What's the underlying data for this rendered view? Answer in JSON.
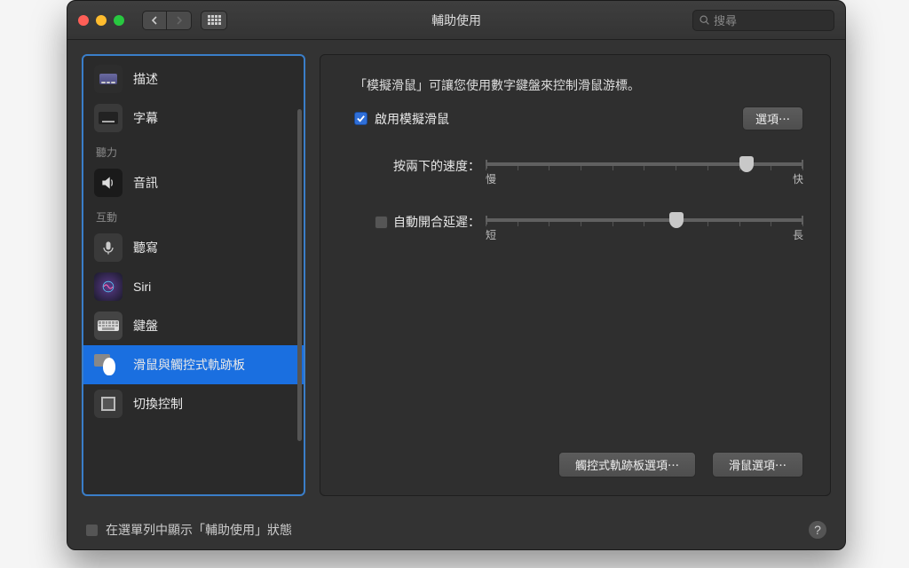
{
  "titlebar": {
    "title": "輔助使用",
    "search_placeholder": "搜尋"
  },
  "sidebar": {
    "categories": [
      {
        "label": "",
        "items": [
          {
            "key": "description",
            "label": "描述"
          },
          {
            "key": "subtitles",
            "label": "字幕"
          }
        ]
      },
      {
        "label": "聽力",
        "items": [
          {
            "key": "audio",
            "label": "音訊"
          }
        ]
      },
      {
        "label": "互動",
        "items": [
          {
            "key": "dictation",
            "label": "聽寫"
          },
          {
            "key": "siri",
            "label": "Siri"
          },
          {
            "key": "keyboard",
            "label": "鍵盤"
          },
          {
            "key": "mouse",
            "label": "滑鼠與觸控式軌跡板",
            "selected": true
          },
          {
            "key": "switch",
            "label": "切換控制"
          }
        ]
      }
    ]
  },
  "pane": {
    "description": "「模擬滑鼠」可讓您使用數字鍵盤來控制滑鼠游標。",
    "enable_label": "啟用模擬滑鼠",
    "enable_checked": true,
    "options_button": "選項⋯",
    "sliders": [
      {
        "label": "按兩下的速度：",
        "min_label": "慢",
        "max_label": "快",
        "value": 0.82,
        "checked": null
      },
      {
        "label": "自動開合延遲：",
        "min_label": "短",
        "max_label": "長",
        "value": 0.6,
        "checked": false
      }
    ],
    "buttons": {
      "trackpad_options": "觸控式軌跡板選項⋯",
      "mouse_options": "滑鼠選項⋯"
    }
  },
  "footer": {
    "show_status_label": "在選單列中顯示「輔助使用」狀態",
    "show_status_checked": false
  }
}
